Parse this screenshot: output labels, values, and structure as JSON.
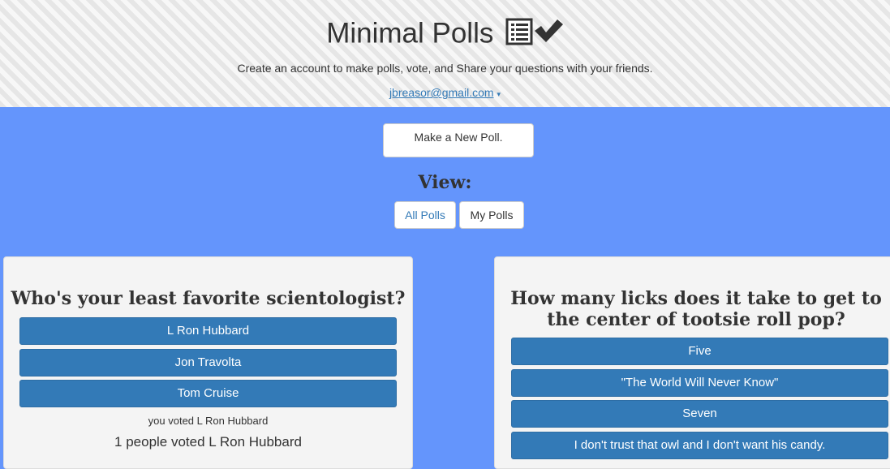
{
  "header": {
    "title": "Minimal Polls",
    "logo_icon": "checklist-icon",
    "subtitle": "Create an account to make polls, vote, and Share your questions with your friends.",
    "user_email": "jbreasor@gmail.com",
    "user_caret": "▾"
  },
  "actions": {
    "new_poll_label": "Make a New Poll.",
    "view_label": "View:",
    "all_polls_label": "All Polls",
    "my_polls_label": "My Polls"
  },
  "polls": [
    {
      "question": "Who's your least favorite scientologist?",
      "options": [
        "L Ron Hubbard",
        "Jon Travolta",
        "Tom Cruise"
      ],
      "you_voted": "you voted L Ron Hubbard",
      "tally": "1 people voted L Ron Hubbard"
    },
    {
      "question": "How many licks does it take to get to the center of tootsie roll pop?",
      "options": [
        "Five",
        "\"The World Will Never Know\"",
        "Seven",
        "I don't trust that owl and I don't want his candy."
      ]
    }
  ],
  "colors": {
    "background": "#6495fc",
    "button_primary": "#337ab7",
    "card": "#f4f4f4"
  }
}
